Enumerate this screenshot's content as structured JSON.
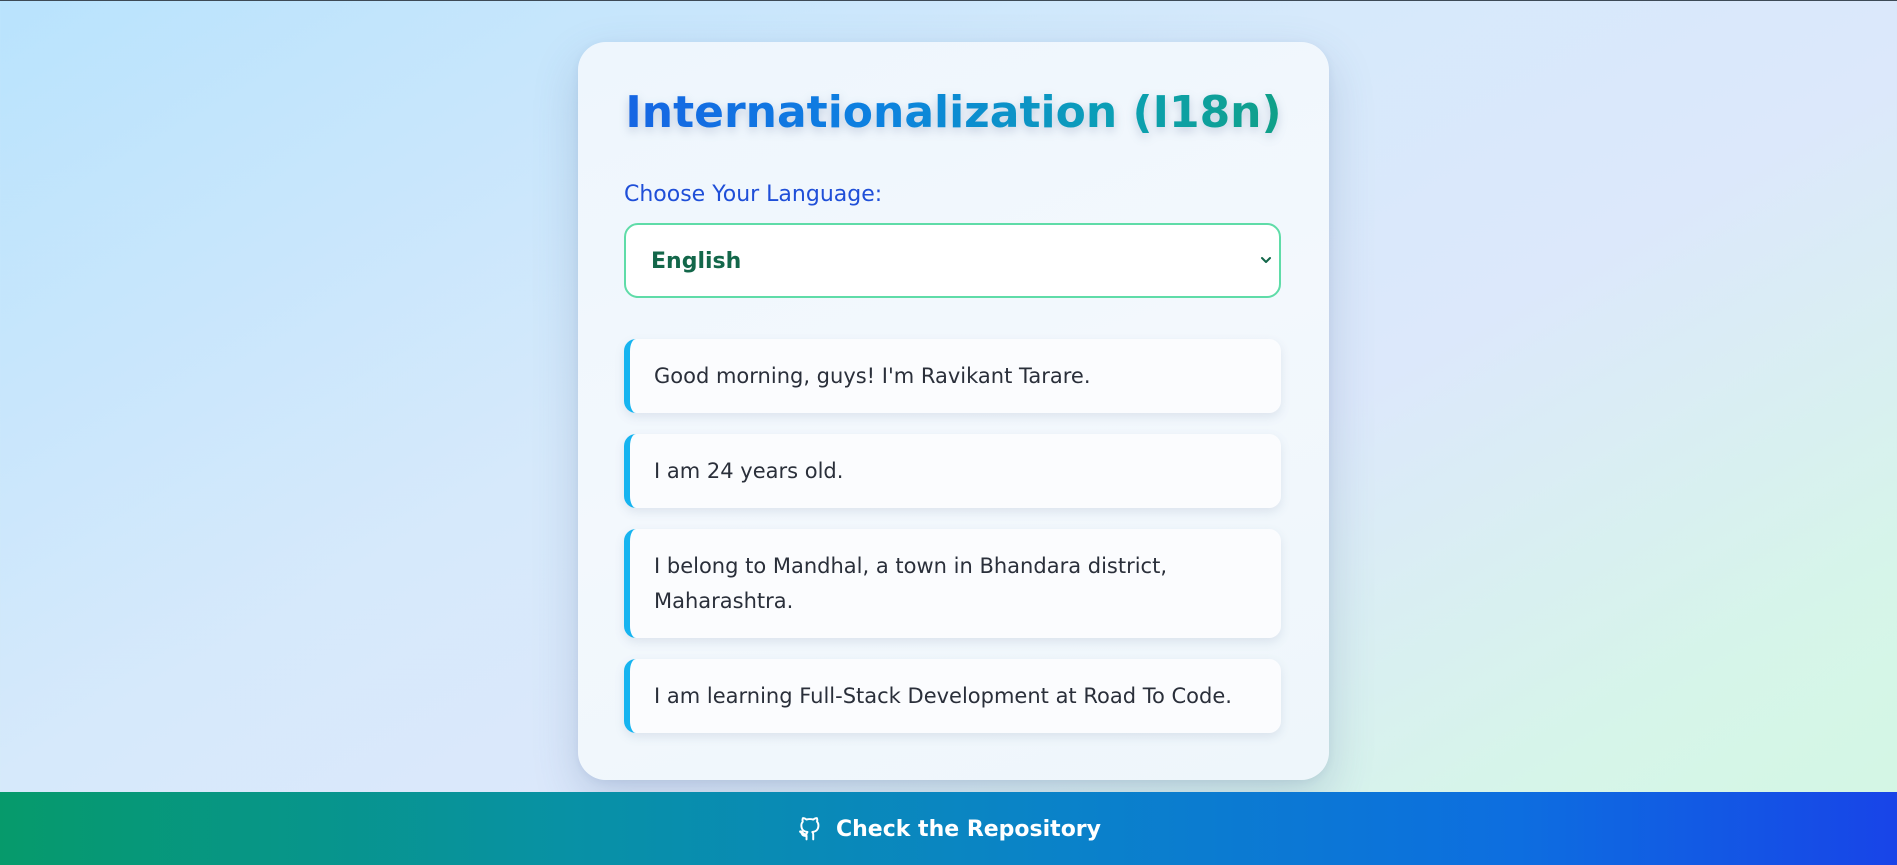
{
  "card": {
    "title": "Internationalization (I18n)",
    "language_label": "Choose Your Language:",
    "language_select": {
      "selected": "English",
      "icon": "chevron-down-icon"
    },
    "messages": [
      "Good morning, guys! I'm Ravikant Tarare.",
      "I am 24 years old.",
      "I belong to Mandhal, a town in Bhandara district, Maharashtra.",
      "I am learning Full-Stack Development at Road To Code."
    ]
  },
  "footer": {
    "link_label": "Check the Repository",
    "icon": "github-icon"
  },
  "colors": {
    "accent_border": "#16b4f0",
    "select_border": "#5fdca8",
    "label_blue": "#1f4fd8",
    "select_text": "#13674a"
  }
}
